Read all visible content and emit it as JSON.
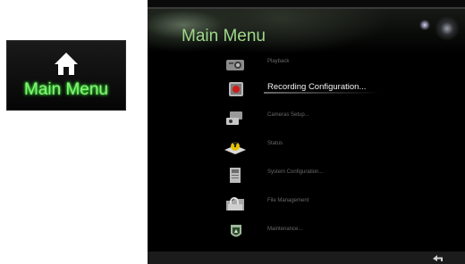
{
  "thumbnail": {
    "label": "Main Menu",
    "icon": "home-icon"
  },
  "panel": {
    "title": "Main Menu",
    "menu": [
      {
        "label": "Playback",
        "icon": "playback-icon",
        "selected": false
      },
      {
        "label": "Recording Configuration...",
        "icon": "recording-icon",
        "selected": true
      },
      {
        "label": "Cameras Setup...",
        "icon": "camera-icon",
        "selected": false
      },
      {
        "label": "Status",
        "icon": "status-icon",
        "selected": false
      },
      {
        "label": "System Configuration...",
        "icon": "system-config-icon",
        "selected": false
      },
      {
        "label": "File Management",
        "icon": "folder-icon",
        "selected": false
      },
      {
        "label": "Maintenance...",
        "icon": "maintenance-icon",
        "selected": false
      }
    ],
    "back_icon": "back-arrow-icon"
  }
}
